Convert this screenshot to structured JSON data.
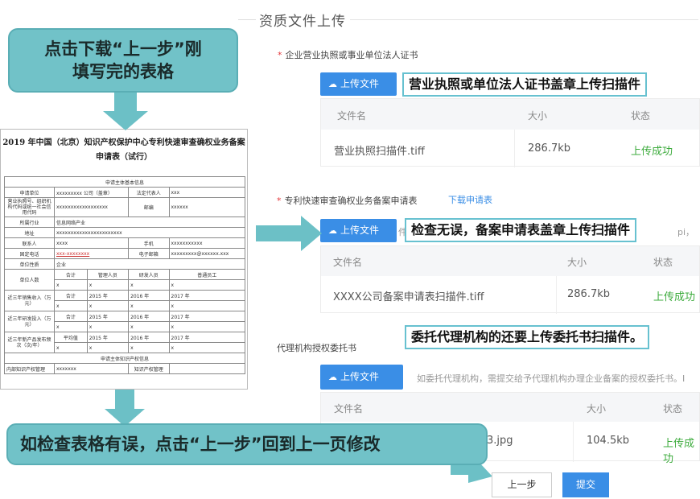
{
  "section_title": "资质文件上传",
  "license_section": {
    "label": "企业营业执照或事业单位法人证书",
    "required_mark": "*",
    "upload_label": "上传文件",
    "callout": "营业执照或单位法人证书盖章上传扫描件",
    "headers": [
      "文件名",
      "大小",
      "状态"
    ],
    "rows": [
      {
        "name": "营业执照扫描件.tiff",
        "size": "286.7kb",
        "status": "上传成功"
      }
    ]
  },
  "application_section": {
    "label": "专利快速审查确权业务备案申请表",
    "required_mark": "*",
    "download_link": "下载申请表",
    "upload_label": "上传文件",
    "callout": "检查无误，备案申请表盖章上传扫描件",
    "hint_tail": "pi，",
    "hint_mid": "件",
    "headers": [
      "文件名",
      "大小",
      "状态"
    ],
    "rows": [
      {
        "name": "XXXX公司备案申请表扫描件.tiff",
        "size": "286.7kb",
        "status": "上传成功"
      }
    ]
  },
  "agency_section": {
    "label": "代理机构授权委托书",
    "upload_label": "上传文件",
    "callout": "委托代理机构的还要上传委托书扫描件。",
    "hint": "如委托代理机构，需提交给予代理机构办理企业备案的授权委托书。I",
    "headers": [
      "文件名",
      "大小",
      "状态"
    ],
    "rows": [
      {
        "name": "3.jpg",
        "size": "104.5kb",
        "status": "上传成功"
      }
    ]
  },
  "bubbles": {
    "download": "点击下载“上一步”刚\n填写完的表格",
    "back": "如检查表格有误，点击“上一步”回到上一页修改"
  },
  "buttons": {
    "prev": "上一步",
    "submit": "提交"
  },
  "form_preview": {
    "title": "2019 年中国（北京）知识产权保护中心专利快速审查确权业务备案申请表（试行）",
    "section1": "申请主体基本信息",
    "section2": "申请主体知识产权信息",
    "rows": [
      [
        "申请单位",
        "xxxxxxxxx 公司（盖章）",
        "法定代表人",
        "xxx"
      ],
      [
        "营业执照号、组织机构代码或统一社会信用代码",
        "xxxxxxxxxxxxxxxxxx",
        "邮编",
        "xxxxxx"
      ],
      [
        "所属行业",
        "信息网络产业",
        "",
        ""
      ],
      [
        "地址",
        "xxxxxxxxxxxxxxxxxxxxxxx",
        "",
        ""
      ],
      [
        "联系人",
        "xxxx",
        "手机",
        "xxxxxxxxxxx"
      ],
      [
        "固定电话",
        "xxx-xxxxxxxx",
        "电子邮箱",
        "xxxxxxxxx@xxxxxx.xxx"
      ],
      [
        "单位性质",
        "企业",
        "",
        ""
      ]
    ],
    "people_row": [
      "单位人数",
      "合计",
      "管理人员",
      "研发人员",
      "普通员工"
    ],
    "sales_row": [
      "近三年销售收入（万元）",
      "合计",
      "2015 年",
      "2016 年",
      "2017 年"
    ],
    "rd_row": [
      "近三年研发投入（万元）",
      "合计",
      "2015 年",
      "2016 年",
      "2017 年"
    ],
    "product_row": [
      "近三年新产品发布频次（次/年）",
      "平均值",
      "2015 年",
      "2016 年",
      "2017 年"
    ],
    "ip_row": [
      "内部知识产权管理",
      "xxxxxxx",
      "知识产权管理",
      ""
    ],
    "x": "x"
  }
}
